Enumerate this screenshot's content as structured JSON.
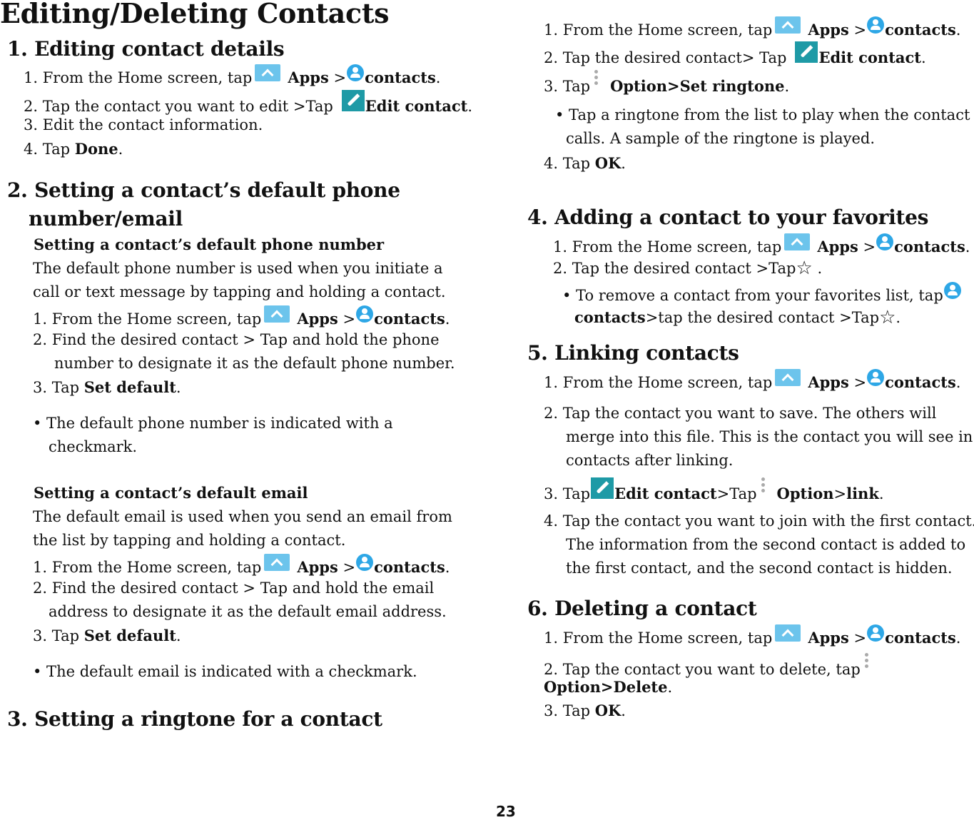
{
  "title": "Editing/Deleting Contacts",
  "icons": {
    "apps": "apps-icon (caret up)",
    "contacts": "contacts-icon (person)",
    "edit": "edit-icon (pencil)",
    "option": "more-options-icon (vertical dots)",
    "star": "star-icon"
  },
  "common": {
    "from_home": "1. From the Home screen, tap",
    "apps": "Apps",
    "gt": ">",
    "contacts": "contacts",
    "dot": ".",
    "edit_contact": "Edit contact",
    "option": "Option",
    "set_default": "Set default",
    "tap": "3. Tap"
  },
  "s1": {
    "heading": "1. Editing contact details",
    "step2_pre": "2. Tap the contact you want to edit >Tap",
    "step3": "3. Edit the contact information.",
    "step4_pre": "4. Tap",
    "step4_bold": "Done"
  },
  "s2": {
    "heading_l1": "2. Setting a contact’s default phone",
    "heading_l2": "number/email",
    "phone": {
      "subheading": "Setting a contact’s default phone number",
      "desc_l1": "The default phone number is used when you initiate a",
      "desc_l2": "call or text message by tapping and holding a contact.",
      "step2_l1": "2. Find the desired contact > Tap and hold the phone",
      "step2_l2": "number to designate it as the default phone number.",
      "bullet_l1": "• The default phone number is indicated with a",
      "bullet_l2": "checkmark."
    },
    "email": {
      "subheading": "Setting a contact’s default email",
      "desc_l1": "The default email is used when you send an email from",
      "desc_l2": "the list by tapping and holding a contact.",
      "step2_l1": "2. Find the desired contact > Tap and hold the email",
      "step2_l2": "address to designate it as the default email address.",
      "bullet": "• The default email is indicated with a checkmark."
    }
  },
  "s3": {
    "heading": "3. Setting a ringtone for a contact",
    "step2_pre": "2. Tap the desired contact> Tap",
    "step3_pre": "3. Tap",
    "step3_bold": "Option>Set ringtone",
    "bullet_l1": "• Tap a ringtone from the list to play when the contact",
    "bullet_l2": "calls. A sample of the ringtone is played.",
    "step4_pre": "4. Tap",
    "step4_bold": "OK"
  },
  "s4": {
    "heading": "4. Adding a contact to your favorites",
    "step2_pre": "2. Tap the desired contact >Tap",
    "bullet_pre": "• To remove a contact from your favorites list, tap",
    "bullet_l2_mid": ">tap the desired contact >Tap"
  },
  "s5": {
    "heading": "5. Linking contacts",
    "step2_l1": "2. Tap the contact you want to save. The others will",
    "step2_l2": "merge into this file. This is the contact you will see in",
    "step2_l3": "contacts after linking.",
    "step3_pre": "3. Tap",
    "step3_mid": ">Tap",
    "link": "link",
    "step4_l1": "4. Tap the contact you want to join with the first contact.",
    "step4_l2": "The information from the second contact is added to",
    "step4_l3": "the first contact, and the second contact is hidden."
  },
  "s6": {
    "heading": "6. Deleting a contact",
    "step2_pre": "2. Tap the contact you want to delete, tap",
    "step2_bold": "Option>Delete",
    "step3_pre": "3. Tap",
    "step3_bold": "OK"
  },
  "page_number": "23"
}
